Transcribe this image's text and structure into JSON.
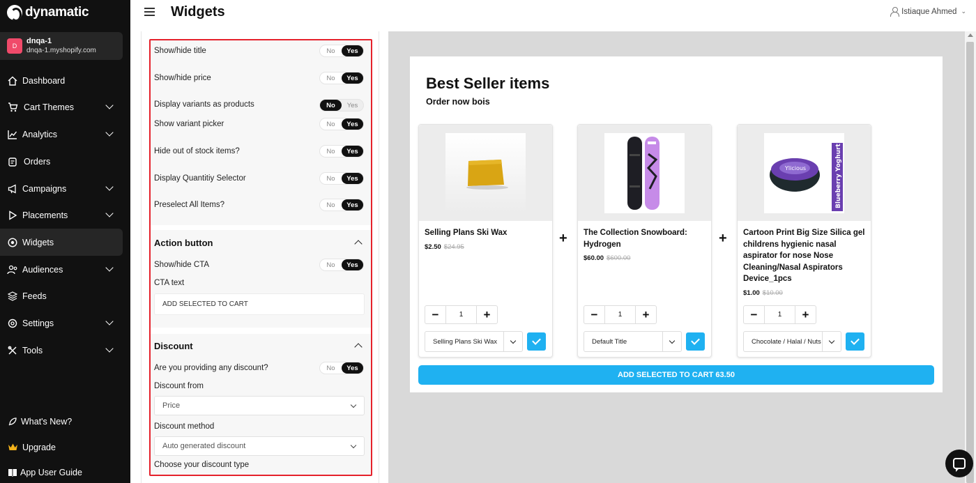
{
  "app": {
    "name": "dynamatic"
  },
  "store": {
    "initial": "D",
    "name": "dnqa-1",
    "domain": "dnqa-1.myshopify.com"
  },
  "nav": [
    {
      "label": "Dashboard",
      "icon": "home-icon"
    },
    {
      "label": "Cart Themes",
      "icon": "cart-icon"
    },
    {
      "label": "Analytics",
      "icon": "chart-icon"
    },
    {
      "label": "Orders",
      "icon": "orders-icon"
    },
    {
      "label": "Campaigns",
      "icon": "megaphone-icon"
    },
    {
      "label": "Placements",
      "icon": "play-icon"
    },
    {
      "label": "Widgets",
      "icon": "widget-icon"
    },
    {
      "label": "Audiences",
      "icon": "audience-icon"
    },
    {
      "label": "Feeds",
      "icon": "feeds-icon"
    },
    {
      "label": "Settings",
      "icon": "settings-icon"
    },
    {
      "label": "Tools",
      "icon": "tools-icon"
    }
  ],
  "nav_bottom": [
    {
      "label": "What's New?",
      "icon": "rocket-icon"
    },
    {
      "label": "Upgrade",
      "icon": "crown-icon"
    },
    {
      "label": "App User Guide",
      "icon": "book-icon"
    }
  ],
  "header": {
    "title": "Widgets",
    "user": "Istiaque Ahmed"
  },
  "settings": {
    "toggle_no": "No",
    "toggle_yes": "Yes",
    "rows": [
      {
        "label": "Show/hide title",
        "value": "Yes"
      },
      {
        "label": "Show/hide price",
        "value": "Yes"
      },
      {
        "label": "Display variants as products",
        "value": "No"
      },
      {
        "label": "Show variant picker",
        "value": "Yes"
      },
      {
        "label": "Hide out of stock items?",
        "value": "Yes"
      },
      {
        "label": "Display Quantitiy Selector",
        "value": "Yes"
      },
      {
        "label": "Preselect All Items?",
        "value": "Yes"
      }
    ],
    "action": {
      "title": "Action button",
      "show_cta_label": "Show/hide CTA",
      "show_cta_value": "Yes",
      "cta_text_label": "CTA text",
      "cta_text_value": "ADD SELECTED TO CART"
    },
    "discount": {
      "title": "Discount",
      "providing_label": "Are you providing any discount?",
      "providing_value": "Yes",
      "from_label": "Discount from",
      "from_value": "Price",
      "method_label": "Discount method",
      "method_value": "Auto generated discount",
      "type_label": "Choose your discount type"
    }
  },
  "preview": {
    "title": "Best Seller items",
    "subtitle": "Order now bois",
    "plus": "+",
    "products": [
      {
        "name": "Selling Plans Ski Wax",
        "price": "$2.50",
        "compare": "$24.95",
        "qty": "1",
        "variant": "Selling Plans Ski Wax"
      },
      {
        "name": "The Collection Snowboard: Hydrogen",
        "price": "$60.00",
        "compare": "$600.00",
        "qty": "1",
        "variant": "Default Title"
      },
      {
        "name": "Cartoon Print Big Size Silica gel childrens hygienic nasal aspirator for nose Nose Cleaning/Nasal Aspirators Device_1pcs",
        "price": "$1.00",
        "compare": "$10.00",
        "qty": "1",
        "variant": "Chocolate / Halal / Nuts"
      }
    ],
    "cta": "ADD SELECTED TO CART 63.50"
  },
  "colors": {
    "accent": "#1fb1f1",
    "sidebar": "#111111",
    "highlight": "#e5212b"
  }
}
